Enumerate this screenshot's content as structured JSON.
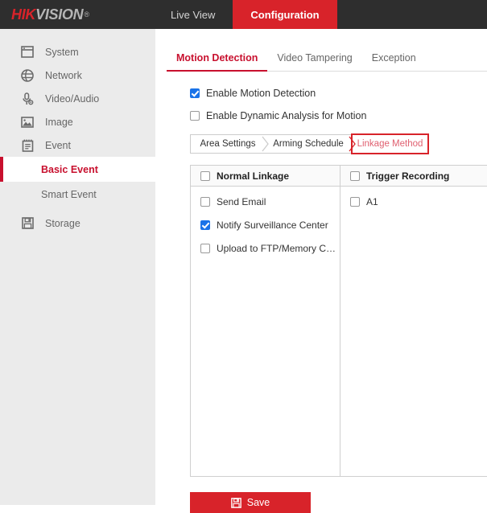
{
  "header": {
    "brand_primary": "HIK",
    "brand_secondary": "VISION",
    "brand_reg": "®",
    "brand_color": "#d8232a",
    "bar_color": "#2e2e2e",
    "nav": [
      {
        "label": "Live View",
        "active": false
      },
      {
        "label": "Configuration",
        "active": true
      }
    ]
  },
  "sidebar": {
    "background": "#ebebeb",
    "accent": "#c8102e",
    "items": [
      {
        "label": "System",
        "icon": "window-icon"
      },
      {
        "label": "Network",
        "icon": "globe-icon"
      },
      {
        "label": "Video/Audio",
        "icon": "microphone-icon"
      },
      {
        "label": "Image",
        "icon": "picture-icon"
      },
      {
        "label": "Event",
        "icon": "clipboard-icon"
      }
    ],
    "sub_items": [
      {
        "label": "Basic Event",
        "active": true
      },
      {
        "label": "Smart Event",
        "active": false
      }
    ],
    "bottom_items": [
      {
        "label": "Storage",
        "icon": "floppy-disk-icon"
      }
    ]
  },
  "main": {
    "tabs": [
      {
        "label": "Motion Detection",
        "active": true
      },
      {
        "label": "Video Tampering",
        "active": false
      },
      {
        "label": "Exception",
        "active": false
      }
    ],
    "options": [
      {
        "label": "Enable Motion Detection",
        "checked": true
      },
      {
        "label": "Enable Dynamic Analysis for Motion",
        "checked": false
      }
    ],
    "steps": [
      {
        "label": "Area Settings",
        "selected": false
      },
      {
        "label": "Arming Schedule",
        "selected": false
      },
      {
        "label": "Linkage Method",
        "selected": true
      }
    ],
    "linkage_table": {
      "columns": [
        {
          "header": "Normal Linkage",
          "header_checked": false,
          "rows": [
            {
              "label": "Send Email",
              "checked": false
            },
            {
              "label": "Notify Surveillance Center",
              "checked": true
            },
            {
              "label": "Upload to FTP/Memory Card/...",
              "checked": false
            }
          ]
        },
        {
          "header": "Trigger Recording",
          "header_checked": false,
          "rows": [
            {
              "label": "A1",
              "checked": false
            }
          ]
        }
      ]
    },
    "save": {
      "label": "Save",
      "icon": "floppy-disk-icon",
      "color": "#d8232a"
    }
  }
}
